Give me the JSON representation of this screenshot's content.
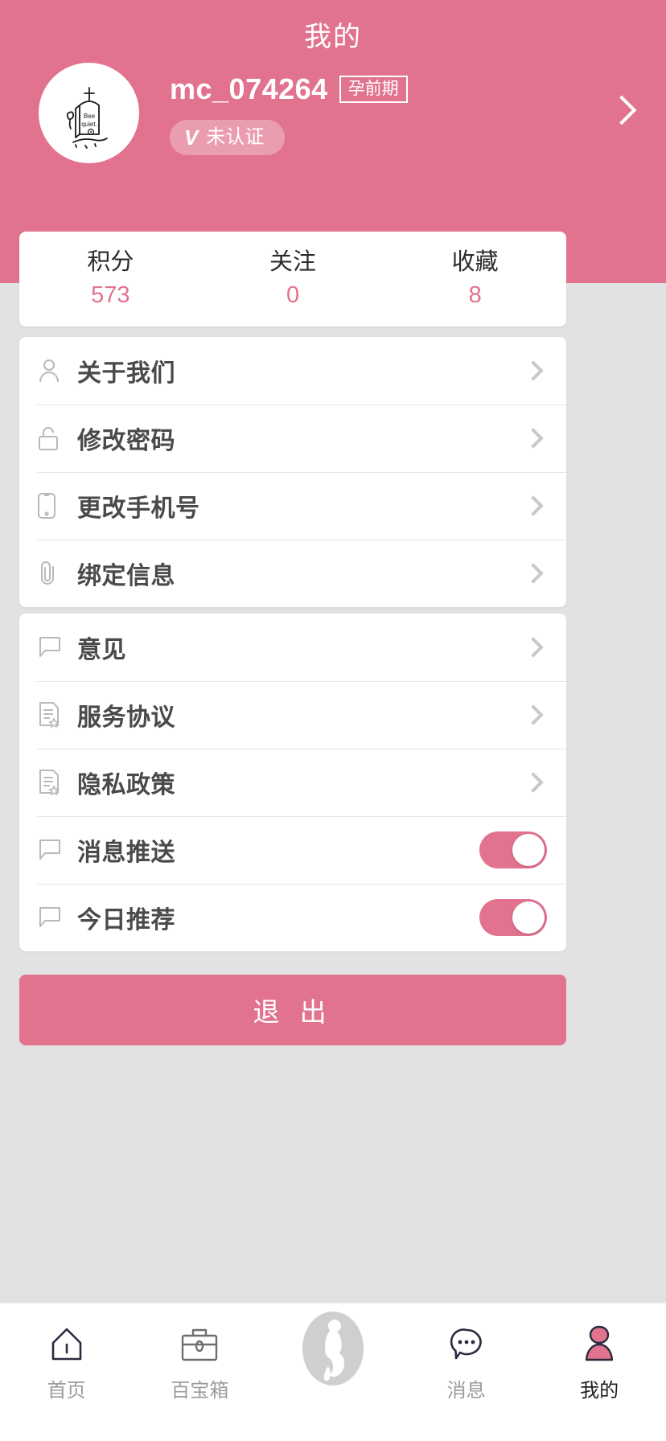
{
  "header": {
    "title": "我的",
    "username": "mc_074264",
    "stage_badge": "孕前期",
    "verify_badge": "未认证",
    "avatar_caption_line1": "Bee",
    "avatar_caption_line2": "quiet.",
    "accent_color": "#e2738f"
  },
  "stats": [
    {
      "label": "积分",
      "value": "573"
    },
    {
      "label": "关注",
      "value": "0"
    },
    {
      "label": "收藏",
      "value": "8"
    }
  ],
  "account_menu": [
    {
      "label": "关于我们",
      "icon": "person-icon"
    },
    {
      "label": "修改密码",
      "icon": "lock-icon"
    },
    {
      "label": "更改手机号",
      "icon": "phone-icon"
    },
    {
      "label": "绑定信息",
      "icon": "paperclip-icon"
    }
  ],
  "general_menu": [
    {
      "label": "意见",
      "icon": "chat-bubble-icon",
      "type": "link"
    },
    {
      "label": "服务协议",
      "icon": "document-star-icon",
      "type": "link"
    },
    {
      "label": "隐私政策",
      "icon": "document-star-icon",
      "type": "link"
    },
    {
      "label": "消息推送",
      "icon": "chat-bubble-icon",
      "type": "toggle",
      "state": "on"
    },
    {
      "label": "今日推荐",
      "icon": "chat-bubble-icon",
      "type": "toggle",
      "state": "on"
    }
  ],
  "logout": {
    "label": "退 出"
  },
  "bottom_nav": [
    {
      "label": "首页",
      "icon": "home-icon",
      "active": false
    },
    {
      "label": "百宝箱",
      "icon": "toolbox-icon",
      "active": false
    },
    {
      "label": "",
      "icon": "pregnant-woman-icon",
      "active": false
    },
    {
      "label": "消息",
      "icon": "message-bubble-icon",
      "active": false
    },
    {
      "label": "我的",
      "icon": "profile-person-icon",
      "active": true
    }
  ]
}
